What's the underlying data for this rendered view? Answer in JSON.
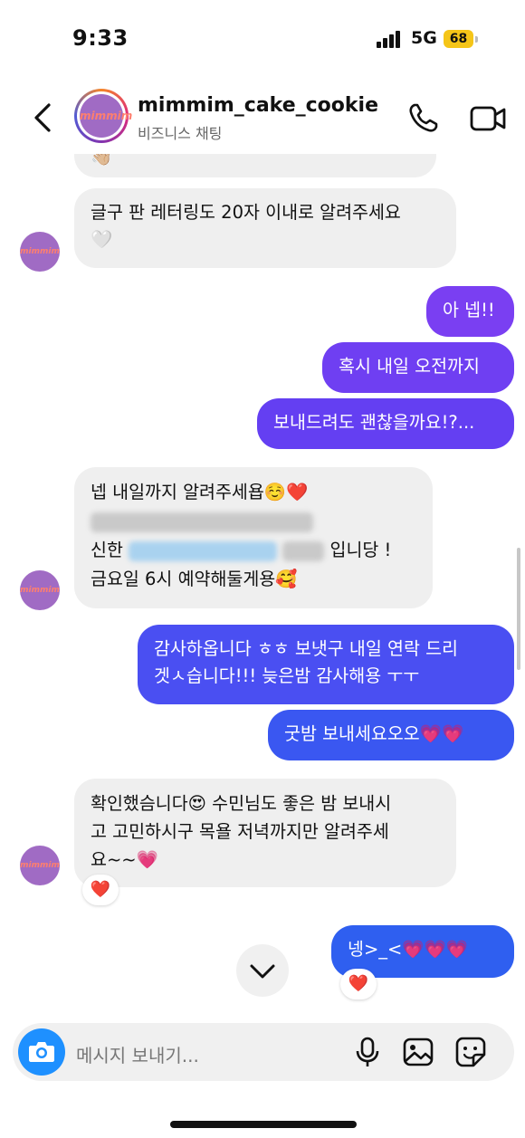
{
  "status_bar": {
    "time": "9:33",
    "network": "5G",
    "battery": "68"
  },
  "header": {
    "username": "mimmim_cake_cookie",
    "subtitle": "비즈니스 채팅",
    "avatar_text": "mimmim"
  },
  "messages": {
    "m0": "👋🏼",
    "m1_line1": "글구 판 레터링도 20자 이내로 알려주세요",
    "m1_line2": "🤍",
    "m2": "아 넵!!",
    "m3": "혹시 내일 오전까지",
    "m4": "보내드려도 괜찮을까요!?...",
    "m5_line1": "넵 내일까지 알려주세욥☺️❤️",
    "m5_line3_prefix": "신한",
    "m5_line3_suffix": "입니당 !",
    "m5_line4": "금요일 6시 예약해둘게용🥰",
    "m6_line1": "감사하옵니다 ㅎㅎ 보냇구 내일 연락 드리",
    "m6_line2": "겟ㅅ습니다!!! 늦은밤 감사해용 ㅜㅜ",
    "m7": "굿밤 보내세요오오💗💗",
    "m8_line1": "확인했슴니다😍 수민님도 좋은 밤 보내시",
    "m8_line2": "고 고민하시구 목욜 저녁까지만 알려주세",
    "m8_line3": "요~~💗",
    "m9": "넹>_<💗💗💗"
  },
  "reactions": {
    "r1": "❤️",
    "r2": "❤️"
  },
  "composer": {
    "placeholder": "메시지 보내기..."
  },
  "icons": [
    "back-arrow-icon",
    "phone-icon",
    "video-icon",
    "camera-icon",
    "microphone-icon",
    "image-icon",
    "sticker-icon",
    "chevron-down-icon"
  ],
  "colors": {
    "incoming_bubble": "#efefef",
    "outgoing_top": "#7a3ff2",
    "outgoing_bottom": "#2f5ff0",
    "camera": "#1e90ff"
  }
}
